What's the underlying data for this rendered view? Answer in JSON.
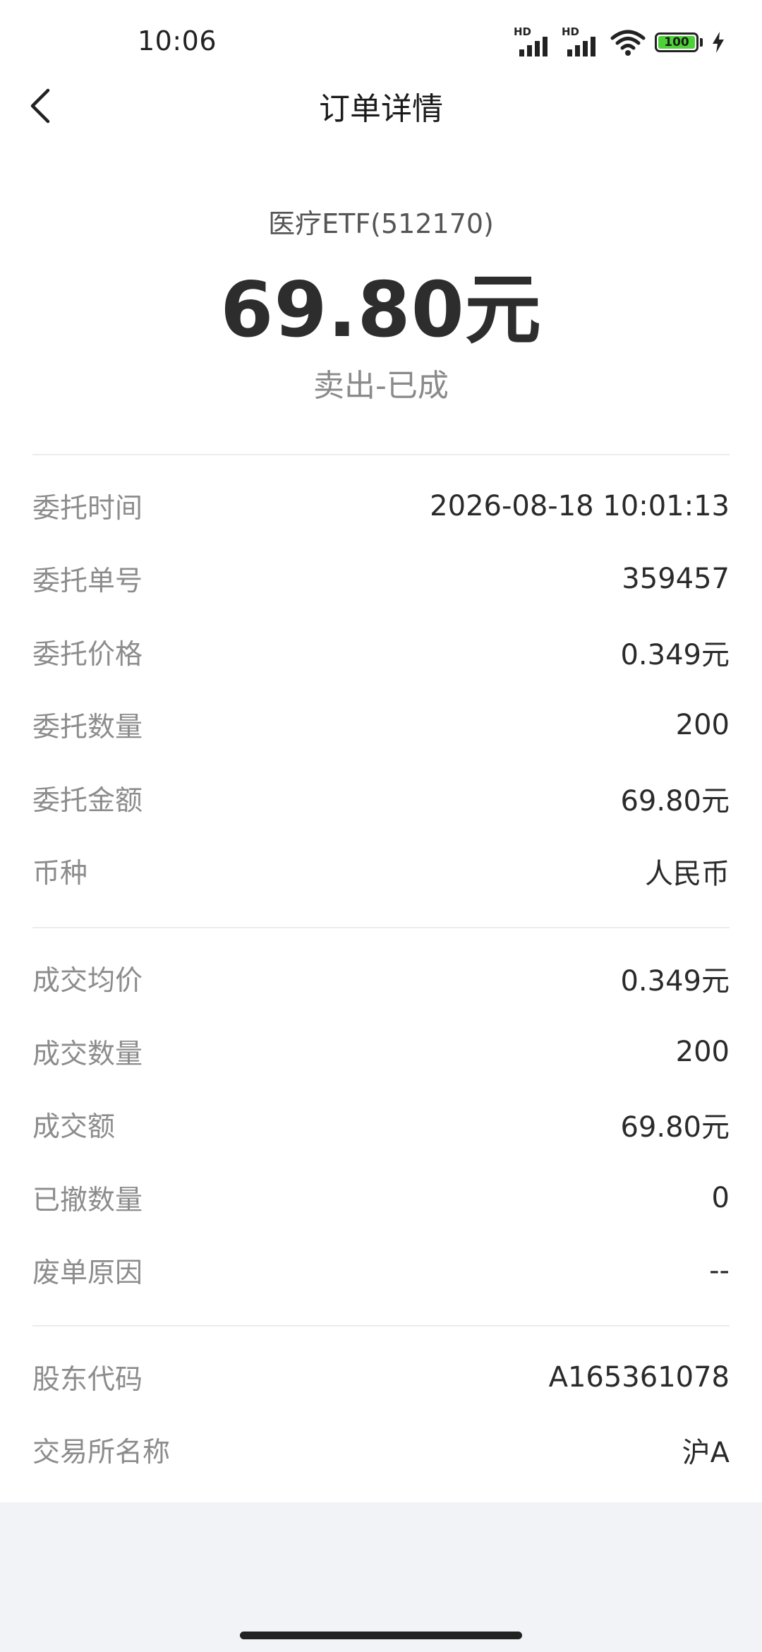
{
  "status_bar": {
    "time": "10:06",
    "signal1_label": "HD",
    "signal2_label": "HD",
    "battery_level": "100"
  },
  "nav": {
    "title": "订单详情",
    "back_icon": "chevron-left-icon"
  },
  "header": {
    "stock_name": "医疗ETF(512170)",
    "amount": "69.80元",
    "status": "卖出-已成"
  },
  "section1": [
    {
      "label": "委托时间",
      "value": "2026-08-18 10:01:13"
    },
    {
      "label": "委托单号",
      "value": "359457"
    },
    {
      "label": "委托价格",
      "value": "0.349元"
    },
    {
      "label": "委托数量",
      "value": "200"
    },
    {
      "label": "委托金额",
      "value": "69.80元"
    },
    {
      "label": "币种",
      "value": "人民币"
    }
  ],
  "section2": [
    {
      "label": "成交均价",
      "value": "0.349元"
    },
    {
      "label": "成交数量",
      "value": "200"
    },
    {
      "label": "成交额",
      "value": "69.80元"
    },
    {
      "label": "已撤数量",
      "value": "0"
    },
    {
      "label": "废单原因",
      "value": "--"
    }
  ],
  "section3": [
    {
      "label": "股东代码",
      "value": "A165361078"
    },
    {
      "label": "交易所名称",
      "value": "沪A"
    }
  ],
  "colors": {
    "background": "#f2f3f7",
    "battery_fill": "#4cd137"
  }
}
